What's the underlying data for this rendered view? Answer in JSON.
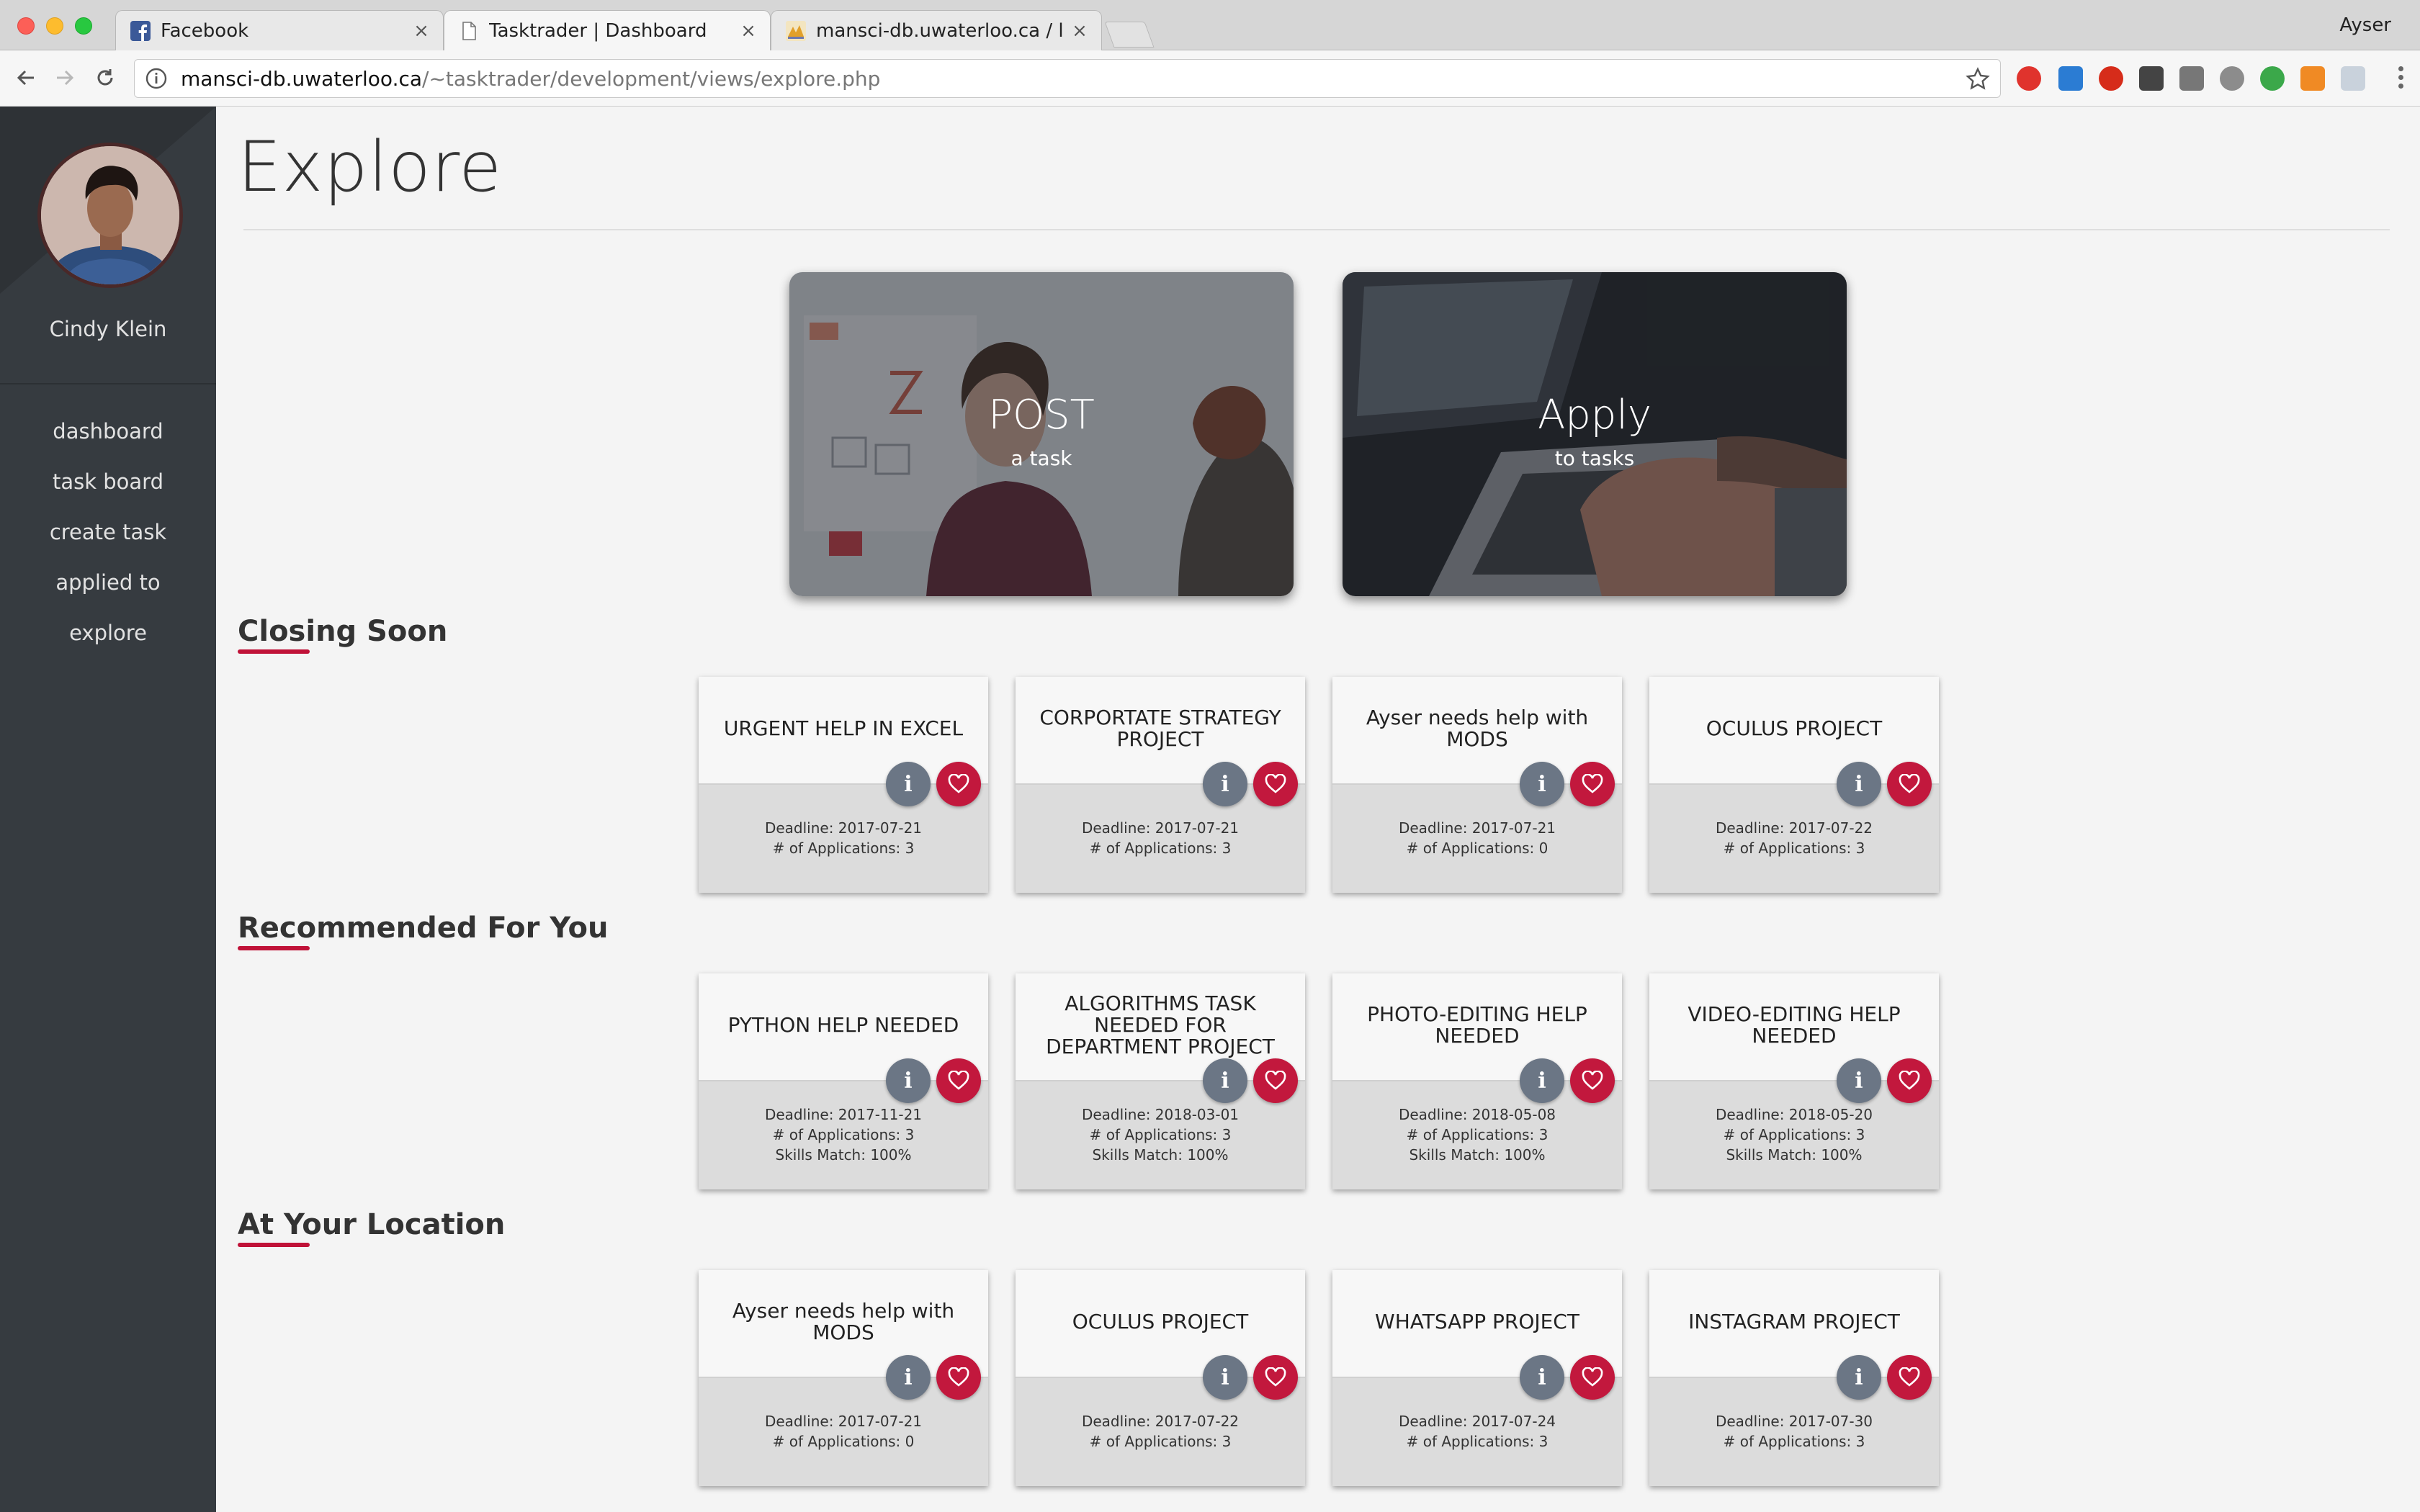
{
  "browser": {
    "tabs": [
      {
        "label": "Facebook",
        "active": false
      },
      {
        "label": "Tasktrader | Dashboard",
        "active": true
      },
      {
        "label": "mansci-db.uwaterloo.ca / localhost",
        "active": false
      }
    ],
    "profile": "Ayser",
    "url_host": "mansci-db.uwaterloo.ca",
    "url_path": "/~tasktrader/development/views/explore.php"
  },
  "sidebar": {
    "user_name": "Cindy Klein",
    "nav": [
      "dashboard",
      "task board",
      "create task",
      "applied to",
      "explore"
    ]
  },
  "page": {
    "title": "Explore",
    "hero": [
      {
        "big": "POST",
        "small": "a task"
      },
      {
        "big": "Apply",
        "small": "to tasks"
      }
    ]
  },
  "sections": [
    {
      "title": "Closing Soon",
      "cards": [
        {
          "title": "URGENT HELP IN EXCEL",
          "lines": [
            "Deadline: 2017-07-21",
            "# of Applications: 3"
          ]
        },
        {
          "title": "CORPORTATE STRATEGY PROJECT",
          "lines": [
            "Deadline: 2017-07-21",
            "# of Applications: 3"
          ]
        },
        {
          "title": "Ayser needs help with MODS",
          "lines": [
            "Deadline: 2017-07-21",
            "# of Applications: 0"
          ]
        },
        {
          "title": "OCULUS PROJECT",
          "lines": [
            "Deadline: 2017-07-22",
            "# of Applications: 3"
          ]
        }
      ]
    },
    {
      "title": "Recommended For You",
      "cards": [
        {
          "title": "PYTHON HELP NEEDED",
          "lines": [
            "Deadline: 2017-11-21",
            "# of Applications: 3",
            "Skills Match: 100%"
          ]
        },
        {
          "title": "ALGORITHMS TASK NEEDED FOR DEPARTMENT PROJECT",
          "lines": [
            "Deadline: 2018-03-01",
            "# of Applications: 3",
            "Skills Match: 100%"
          ]
        },
        {
          "title": "PHOTO-EDITING HELP NEEDED",
          "lines": [
            "Deadline: 2018-05-08",
            "# of Applications: 3",
            "Skills Match: 100%"
          ]
        },
        {
          "title": "VIDEO-EDITING HELP NEEDED",
          "lines": [
            "Deadline: 2018-05-20",
            "# of Applications: 3",
            "Skills Match: 100%"
          ]
        }
      ]
    },
    {
      "title": "At Your Location",
      "cards": [
        {
          "title": "Ayser needs help with MODS",
          "lines": [
            "Deadline: 2017-07-21",
            "# of Applications: 0"
          ]
        },
        {
          "title": "OCULUS PROJECT",
          "lines": [
            "Deadline: 2017-07-22",
            "# of Applications: 3"
          ]
        },
        {
          "title": "WHATSAPP PROJECT",
          "lines": [
            "Deadline: 2017-07-24",
            "# of Applications: 3"
          ]
        },
        {
          "title": "INSTAGRAM PROJECT",
          "lines": [
            "Deadline: 2017-07-30",
            "# of Applications: 3"
          ]
        }
      ]
    }
  ],
  "colors": {
    "sidebar": "#363b40",
    "accent": "#c2183d",
    "info_button": "#6b7685",
    "page_bg": "#f4f4f4"
  }
}
